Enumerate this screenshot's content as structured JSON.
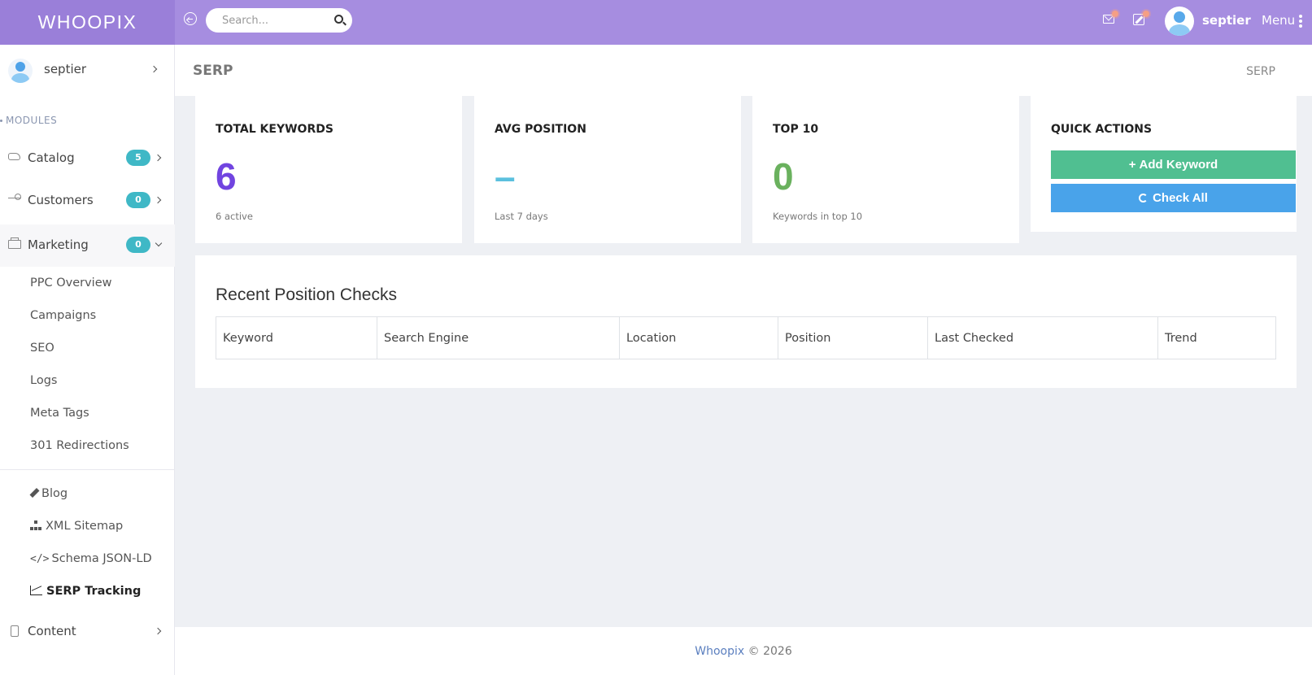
{
  "app": {
    "brand": "WHOOPIX"
  },
  "topbar": {
    "search_placeholder": "Search...",
    "username": "septier",
    "menu_label": "Menu"
  },
  "sidebar": {
    "user": "septier",
    "section_label": "MODULES",
    "items": [
      {
        "label": "Catalog",
        "badge": "5"
      },
      {
        "label": "Customers",
        "badge": "0"
      },
      {
        "label": "Marketing",
        "badge": "0"
      },
      {
        "label": "Content"
      }
    ],
    "marketing_sub": [
      "PPC Overview",
      "Campaigns",
      "SEO",
      "Logs",
      "Meta Tags",
      "301 Redirections"
    ],
    "seo_tools": [
      "Blog",
      "XML Sitemap",
      "Schema JSON-LD",
      "SERP Tracking"
    ]
  },
  "page": {
    "title": "SERP",
    "breadcrumb": "SERP"
  },
  "cards": {
    "total": {
      "title": "TOTAL KEYWORDS",
      "value": "6",
      "sub": "6 active",
      "color": "#7144e0"
    },
    "avg": {
      "title": "AVG POSITION",
      "value": "–",
      "sub": "Last 7 days",
      "color": "#5bc0de"
    },
    "top10": {
      "title": "TOP 10",
      "value": "0",
      "sub": "Keywords in top 10",
      "color": "#6ab15e"
    },
    "actions": {
      "title": "QUICK ACTIONS",
      "add_label": "Add Keyword",
      "check_label": "Check All"
    }
  },
  "recent": {
    "title": "Recent Position Checks",
    "columns": [
      "Keyword",
      "Search Engine",
      "Location",
      "Position",
      "Last Checked",
      "Trend"
    ]
  },
  "footer": {
    "brand": "Whoopix",
    "copyright": "© 2026"
  }
}
